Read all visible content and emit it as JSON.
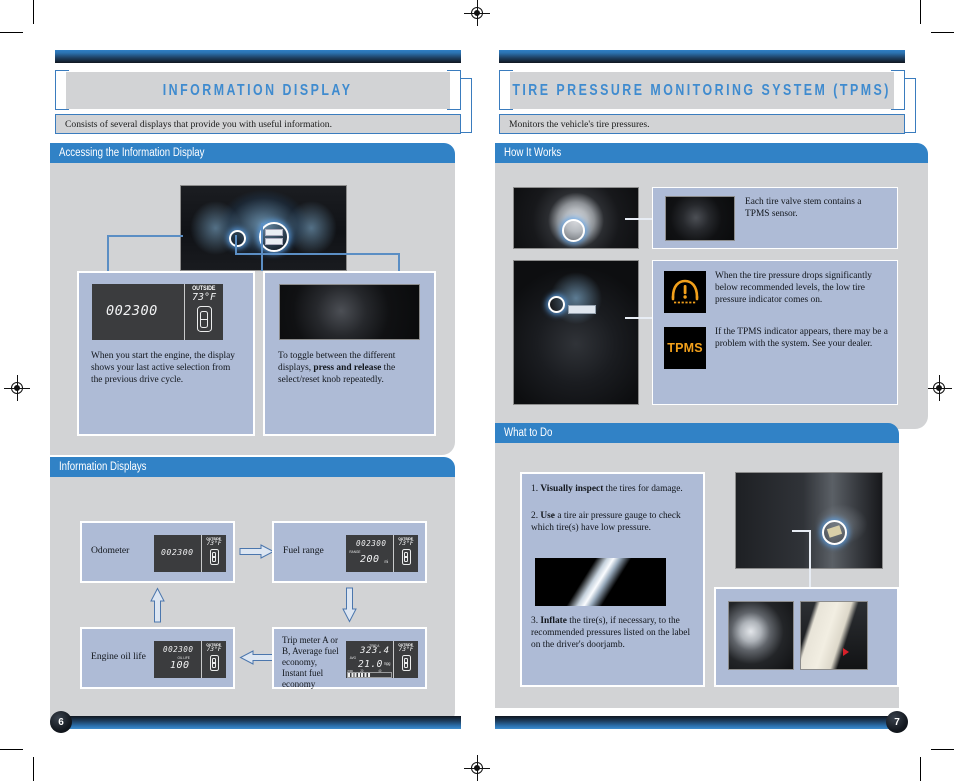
{
  "document": {
    "left_page_number": "6",
    "right_page_number": "7"
  },
  "left_page": {
    "chapter_title": "INFORMATION DISPLAY",
    "chapter_subtitle": "Consists of several displays that provide you with useful information.",
    "sections": [
      {
        "heading": "Accessing the Information Display",
        "panels": [
          {
            "caption_html": "When you start the engine, the display shows your last active selection from the previous drive cycle.",
            "display": {
              "odometer": "002300",
              "outside_label": "OUTSIDE",
              "outside_temp": "73°F"
            }
          },
          {
            "caption_plain": "To toggle between the different displays, ",
            "caption_bold": "press and release",
            "caption_tail": " the select/reset knob repeatedly."
          }
        ]
      },
      {
        "heading": "Information Displays",
        "items": [
          {
            "label": "Odometer",
            "display": {
              "odometer": "002300",
              "outside_label": "OUTSIDE",
              "outside_temp": "73°F"
            }
          },
          {
            "label": "Fuel range",
            "display": {
              "odometer": "002300",
              "range_label": "RANGE",
              "range_value": "200",
              "range_unit": "mi",
              "outside_label": "OUTSIDE",
              "outside_temp": "73°F"
            }
          },
          {
            "label": "Engine oil life",
            "display": {
              "odometer": "002300",
              "oil_label": "OIL LIFE",
              "oil_value": "100",
              "outside_label": "OUTSIDE",
              "outside_temp": "73°F"
            }
          },
          {
            "label": "Trip meter A or B, Average fuel economy, Instant fuel economy",
            "display": {
              "trip_label": "TRIP A",
              "trip_value": "323.4",
              "avg_label": "AVG",
              "avg_value": "21.0",
              "avg_unit": "mpg",
              "bar_label": "mpg",
              "bar_tick_low": "20",
              "bar_tick_high": "40",
              "outside_label": "OUTSIDE",
              "outside_temp": "73°F"
            }
          }
        ]
      }
    ]
  },
  "right_page": {
    "chapter_title": "TIRE PRESSURE MONITORING SYSTEM (TPMS)",
    "chapter_subtitle": "Monitors the vehicle's tire pressures.",
    "sections": [
      {
        "heading": "How It Works",
        "notes": [
          {
            "text": "Each tire valve stem contains a TPMS sensor."
          },
          {
            "text": "When the tire pressure drops significantly below recommended levels, the low tire pressure indicator comes on.",
            "indicator": "low-tire-pressure"
          },
          {
            "text": "If the TPMS indicator appears, there may be a problem with the system. See your dealer.",
            "indicator": "tpms",
            "indicator_label": "TPMS"
          }
        ]
      },
      {
        "heading": "What to Do",
        "steps": [
          {
            "number": "1.",
            "bold": "Visually inspect",
            "rest": " the tires for damage."
          },
          {
            "number": "2.",
            "bold": "Use",
            "rest": " a tire air pressure gauge to check which tire(s) have low pressure."
          },
          {
            "number": "3.",
            "bold": "Inflate",
            "rest": " the tire(s), if necessary, to the recommended pressures listed on the label on the driver's doorjamb."
          }
        ]
      }
    ]
  },
  "colors": {
    "accent_blue": "#3182c6",
    "title_blue": "#3f8bcf",
    "panel_blue": "#aebbd6",
    "body_grey": "#d2d3d5",
    "indicator_amber": "#f2a01b"
  }
}
